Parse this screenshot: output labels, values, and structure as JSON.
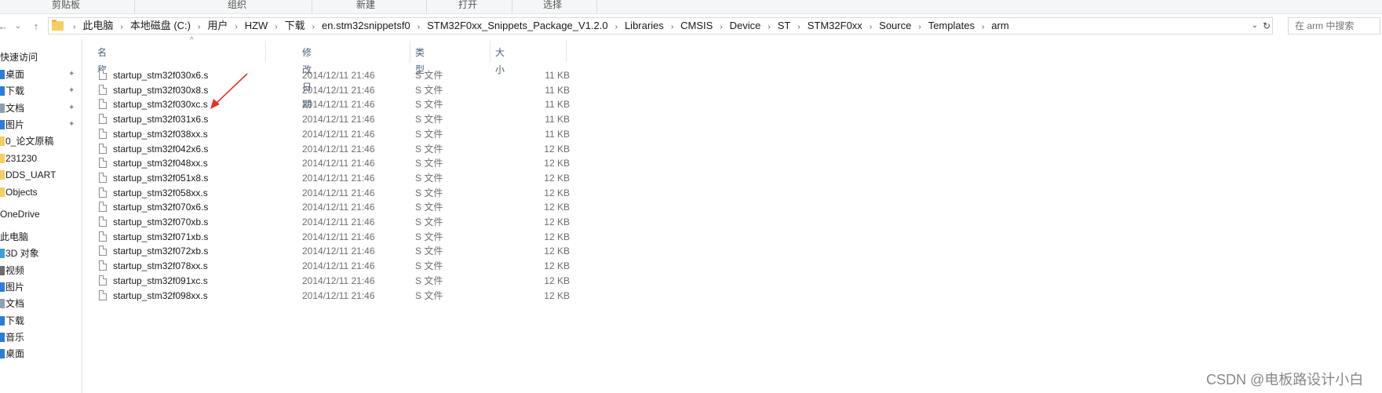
{
  "ribbon": {
    "groups": [
      "剪贴板",
      "组织",
      "新建",
      "打开",
      "选择"
    ]
  },
  "nav_buttons": {
    "back": "←",
    "forward": "→",
    "dropdown": "⌄",
    "up": "↑"
  },
  "address": {
    "crumbs": [
      "此电脑",
      "本地磁盘 (C:)",
      "用户",
      "HZW",
      "下载",
      "en.stm32snippetsf0",
      "STM32F0xx_Snippets_Package_V1.2.0",
      "Libraries",
      "CMSIS",
      "Device",
      "ST",
      "STM32F0xx",
      "Source",
      "Templates",
      "arm"
    ],
    "dropdown_glyph": "⌄",
    "refresh_glyph": "↻"
  },
  "search": {
    "placeholder": "在 arm 中搜索"
  },
  "nav": {
    "items": [
      {
        "label": "快速访问",
        "icon": "star-icon",
        "color": "#2d7cd6",
        "pinned": false
      },
      {
        "label": "桌面",
        "icon": "desktop-icon",
        "color": "#2d7cd6",
        "pinned": true
      },
      {
        "label": "下载",
        "icon": "download-icon",
        "color": "#2d7cd6",
        "pinned": true
      },
      {
        "label": "文档",
        "icon": "document-icon",
        "color": "#8fa0b4",
        "pinned": true
      },
      {
        "label": "图片",
        "icon": "picture-icon",
        "color": "#2d7cd6",
        "pinned": true
      },
      {
        "label": "0_论文原稿",
        "icon": "folder-icon",
        "color": "#f3cf62",
        "pinned": false
      },
      {
        "label": "231230",
        "icon": "folder-icon",
        "color": "#f3cf62",
        "pinned": false
      },
      {
        "label": "DDS_UART",
        "icon": "folder-icon",
        "color": "#f3cf62",
        "pinned": false
      },
      {
        "label": "Objects",
        "icon": "folder-icon",
        "color": "#f3cf62",
        "pinned": false
      },
      {
        "label": "OneDrive",
        "icon": "cloud-icon",
        "color": "#2d7cd6",
        "pinned": false
      },
      {
        "label": "此电脑",
        "icon": "computer-icon",
        "color": "#2d7cd6",
        "pinned": false
      },
      {
        "label": "3D 对象",
        "icon": "cube-icon",
        "color": "#3aa0d8",
        "pinned": false
      },
      {
        "label": "视频",
        "icon": "video-icon",
        "color": "#6d6d6d",
        "pinned": false
      },
      {
        "label": "图片",
        "icon": "picture-icon",
        "color": "#2d7cd6",
        "pinned": false
      },
      {
        "label": "文档",
        "icon": "document-icon",
        "color": "#8fa0b4",
        "pinned": false
      },
      {
        "label": "下载",
        "icon": "download-icon",
        "color": "#2d7cd6",
        "pinned": false
      },
      {
        "label": "音乐",
        "icon": "music-icon",
        "color": "#2d7cd6",
        "pinned": false
      },
      {
        "label": "桌面",
        "icon": "desktop-icon",
        "color": "#2d7cd6",
        "pinned": false
      }
    ],
    "pin_glyph": "📌"
  },
  "columns": {
    "name": "名称",
    "date": "修改日期",
    "type": "类型",
    "size": "大小",
    "sort_glyph": "^"
  },
  "files": [
    {
      "name": "startup_stm32f030x6.s",
      "date": "2014/12/11 21:46",
      "type": "S 文件",
      "size": "11 KB"
    },
    {
      "name": "startup_stm32f030x8.s",
      "date": "2014/12/11 21:46",
      "type": "S 文件",
      "size": "11 KB"
    },
    {
      "name": "startup_stm32f030xc.s",
      "date": "2014/12/11 21:46",
      "type": "S 文件",
      "size": "11 KB"
    },
    {
      "name": "startup_stm32f031x6.s",
      "date": "2014/12/11 21:46",
      "type": "S 文件",
      "size": "11 KB"
    },
    {
      "name": "startup_stm32f038xx.s",
      "date": "2014/12/11 21:46",
      "type": "S 文件",
      "size": "11 KB"
    },
    {
      "name": "startup_stm32f042x6.s",
      "date": "2014/12/11 21:46",
      "type": "S 文件",
      "size": "12 KB"
    },
    {
      "name": "startup_stm32f048xx.s",
      "date": "2014/12/11 21:46",
      "type": "S 文件",
      "size": "12 KB"
    },
    {
      "name": "startup_stm32f051x8.s",
      "date": "2014/12/11 21:46",
      "type": "S 文件",
      "size": "12 KB"
    },
    {
      "name": "startup_stm32f058xx.s",
      "date": "2014/12/11 21:46",
      "type": "S 文件",
      "size": "12 KB"
    },
    {
      "name": "startup_stm32f070x6.s",
      "date": "2014/12/11 21:46",
      "type": "S 文件",
      "size": "12 KB"
    },
    {
      "name": "startup_stm32f070xb.s",
      "date": "2014/12/11 21:46",
      "type": "S 文件",
      "size": "12 KB"
    },
    {
      "name": "startup_stm32f071xb.s",
      "date": "2014/12/11 21:46",
      "type": "S 文件",
      "size": "12 KB"
    },
    {
      "name": "startup_stm32f072xb.s",
      "date": "2014/12/11 21:46",
      "type": "S 文件",
      "size": "12 KB"
    },
    {
      "name": "startup_stm32f078xx.s",
      "date": "2014/12/11 21:46",
      "type": "S 文件",
      "size": "12 KB"
    },
    {
      "name": "startup_stm32f091xc.s",
      "date": "2014/12/11 21:46",
      "type": "S 文件",
      "size": "12 KB"
    },
    {
      "name": "startup_stm32f098xx.s",
      "date": "2014/12/11 21:46",
      "type": "S 文件",
      "size": "12 KB"
    }
  ],
  "annotation": {
    "arrow_color": "#e8302a",
    "target_file": "startup_stm32f030xc.s"
  },
  "watermark": "CSDN @电板路设计小白"
}
